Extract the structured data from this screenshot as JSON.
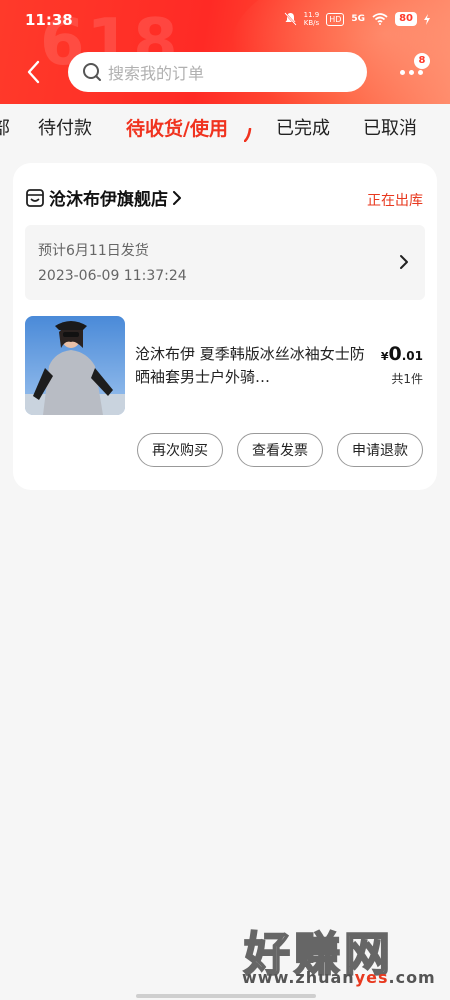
{
  "status_bar": {
    "time": "11:38",
    "net_speed_value": "11.9",
    "net_speed_unit": "KB/s",
    "hd": "HD",
    "signal": "5G",
    "battery": "80"
  },
  "header": {
    "deco_text": "618",
    "search_placeholder": "搜索我的订单",
    "more_badge": "8"
  },
  "tabs": [
    {
      "label": "部"
    },
    {
      "label": "待付款"
    },
    {
      "label": "待收货/使用"
    },
    {
      "label": "已完成"
    },
    {
      "label": "已取消"
    }
  ],
  "order": {
    "shop_name": "沧沐布伊旗舰店",
    "status": "正在出库",
    "shipping_note": "预计6月11日发货",
    "order_time": "2023-06-09 11:37:24",
    "product_title": "沧沐布伊 夏季韩版冰丝冰袖女士防晒袖套男士户外骑…",
    "price_currency": "¥",
    "price_int": "0",
    "price_dec": ".01",
    "quantity": "共1件",
    "buttons": {
      "rebuy": "再次购买",
      "invoice": "查看发票",
      "refund": "申请退款"
    }
  },
  "watermark": {
    "main": "好赚网",
    "url_pre": "www.zhuan",
    "url_hl": "yes",
    "url_post": ".com"
  },
  "colors": {
    "accent": "#f0331f",
    "header_red": "#ff3a2a",
    "background": "#f6f6f6"
  }
}
